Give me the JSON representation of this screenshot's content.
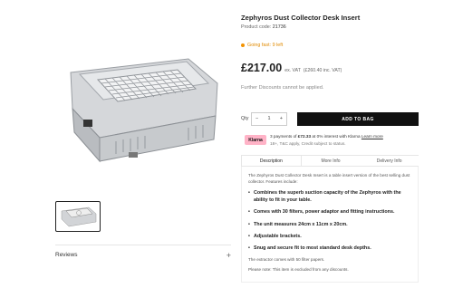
{
  "product": {
    "title": "Zephyros Dust Collector Desk Insert",
    "code_label": "Product code:",
    "code_value": "21736",
    "stock": "Going fast: 9 left",
    "price": "£217.00",
    "ex_vat": "ex. VAT",
    "inc_vat": "(£260.40 inc. VAT)",
    "discounts": "Further Discounts cannot be applied."
  },
  "cart": {
    "qty_label": "Qty",
    "minus": "−",
    "qty_value": "1",
    "plus": "+",
    "add_label": "ADD TO BAG"
  },
  "klarna": {
    "badge": "Klarna",
    "line1_a": "3 payments of ",
    "line1_amount": "£72.33",
    "line1_b": " at 0% interest with Klarna ",
    "learn_more": "Learn more",
    "line2": "18+, T&C apply, Credit subject to status."
  },
  "tabs": [
    "Description",
    "More Info",
    "Delivery Info"
  ],
  "description": {
    "intro": "The Zephyros Dust Collector Desk Insert is a table insert version of the best selling dust collector. Features include:",
    "bullets": [
      "Combines the superb suction capacity of the Zephyros with the ability to fit in your table.",
      "Comes with 30 filters, power adaptor and fitting instructions.",
      "The unit measures 24cm x 11cm x 20cm.",
      "Adjustable brackets.",
      "Snug and secure fit to most standard desk depths."
    ],
    "extra": "The extractor comes with 50 filter papers.",
    "note": "Please note: This item is excluded from any discounts."
  },
  "reviews": {
    "label": "Reviews",
    "toggle": "+"
  },
  "colors": {
    "stock": "#f39200",
    "klarna": "#ffb3c7",
    "button": "#111111"
  }
}
